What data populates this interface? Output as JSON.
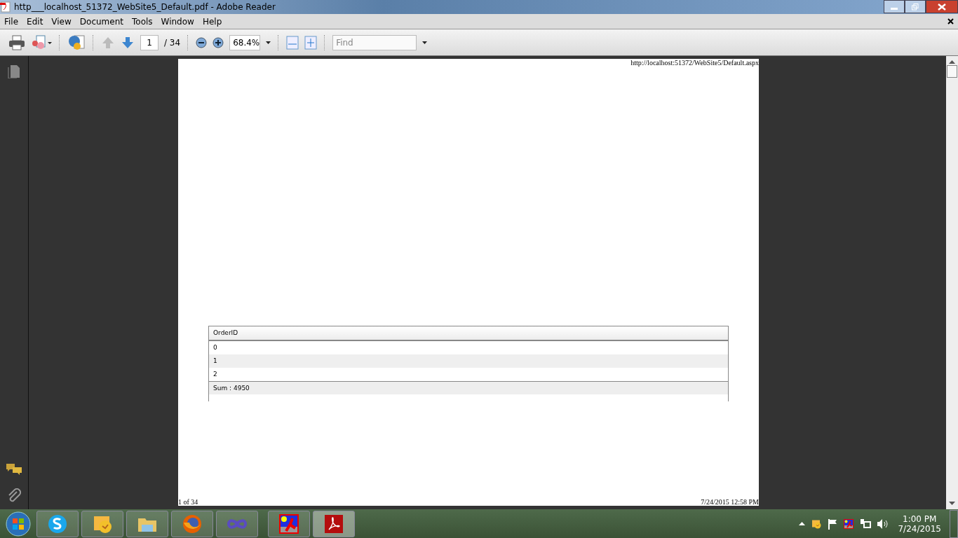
{
  "window": {
    "title": "http___localhost_51372_WebSite5_Default.pdf - Adobe Reader"
  },
  "menu": [
    "File",
    "Edit",
    "View",
    "Document",
    "Tools",
    "Window",
    "Help"
  ],
  "toolbar": {
    "page_number": "1",
    "page_count": "/ 34",
    "zoom": "68.4%",
    "find": {
      "placeholder": "Find"
    }
  },
  "document": {
    "header_url": "http://localhost:51372/WebSite5/Default.aspx",
    "table": {
      "columns": [
        "OrderID"
      ],
      "rows": [
        [
          "0"
        ],
        [
          "1"
        ],
        [
          "2"
        ]
      ],
      "footer": "Sum : 4950"
    },
    "page_label": "1 of 34",
    "printed_at": "7/24/2015 12:58 PM"
  },
  "taskbar": {
    "apps": [
      {
        "kind": "skype",
        "selected": false
      },
      {
        "kind": "outlook",
        "selected": false
      },
      {
        "kind": "folder",
        "selected": false
      },
      {
        "kind": "firefox",
        "selected": false
      },
      {
        "kind": "infinity",
        "selected": false
      },
      {
        "kind": "paint",
        "selected": false
      },
      {
        "kind": "acrobat",
        "selected": true
      }
    ],
    "clock": {
      "time": "1:00 PM",
      "date": "7/24/2015"
    }
  }
}
